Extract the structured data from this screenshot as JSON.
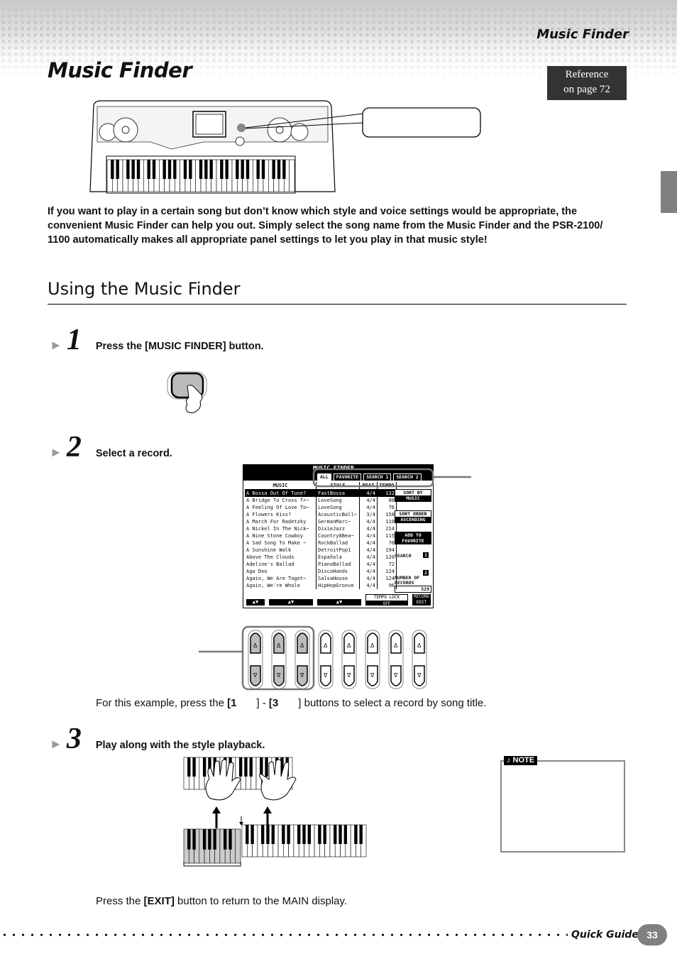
{
  "header": {
    "running_head": "Music Finder",
    "page_title": "Music Finder",
    "reference": {
      "line1": "Reference",
      "line2": "on page 72"
    }
  },
  "intro": "If you want to play in a certain song but don’t know which style and voice settings would be appropriate, the convenient Music Finder can help you out. Simply select the song name from the Music Finder and the PSR-2100/ 1100 automatically makes all appropriate panel settings to let you play in that music style!",
  "section": {
    "title": "Using the Music Finder"
  },
  "steps": [
    {
      "arrow": "►",
      "number": "1",
      "text": "Press the [MUSIC FINDER] button."
    },
    {
      "arrow": "►",
      "number": "2",
      "text": "Select a record."
    },
    {
      "arrow": "►",
      "number": "3",
      "text": "Play along with the style playback."
    }
  ],
  "lcd": {
    "title": "MUSIC FINDER",
    "tabs": [
      {
        "label": "ALL",
        "active": true
      },
      {
        "label": "FAVORITE",
        "active": false
      },
      {
        "label": "SEARCH 1",
        "active": false
      },
      {
        "label": "SEARCH 2",
        "active": false
      }
    ],
    "columns": [
      "MUSIC",
      "STYLE",
      "BEAT",
      "TEMPO"
    ],
    "rows": [
      {
        "music": "A Bossa Out Of Tune?",
        "style": "FastBossa",
        "beat": "4/4",
        "tempo": "132",
        "selected": true
      },
      {
        "music": "A Bridge To Cross Tr~",
        "style": "LoveSong",
        "beat": "4/4",
        "tempo": "80"
      },
      {
        "music": "A Feeling Of Love To~",
        "style": "LoveSong",
        "beat": "4/4",
        "tempo": "76"
      },
      {
        "music": "A Flowers Kiss?",
        "style": "AcousticBall~",
        "beat": "3/4",
        "tempo": "158"
      },
      {
        "music": "A March For Radetzky",
        "style": "GermanMarc~",
        "beat": "4/4",
        "tempo": "110"
      },
      {
        "music": "A Nickel In The Nick~",
        "style": "DixieJazz",
        "beat": "4/4",
        "tempo": "214"
      },
      {
        "music": "A Nine Stone Cowboy",
        "style": "Country8Bea~",
        "beat": "4/4",
        "tempo": "115"
      },
      {
        "music": "A Sad Song To Make ~",
        "style": "RockBallad",
        "beat": "4/4",
        "tempo": "76"
      },
      {
        "music": "A Sunshine Walk",
        "style": "DetroitPop1",
        "beat": "4/4",
        "tempo": "194"
      },
      {
        "music": "Above The Clouds",
        "style": "Española",
        "beat": "4/4",
        "tempo": "120"
      },
      {
        "music": "Adeline's Ballad",
        "style": "PianoBallad",
        "beat": "4/4",
        "tempo": "72"
      },
      {
        "music": "Aga Doo",
        "style": "DiscoHands",
        "beat": "4/4",
        "tempo": "124"
      },
      {
        "music": "Again, We Are Toget~",
        "style": "SalsaHouse",
        "beat": "4/4",
        "tempo": "124"
      },
      {
        "music": "Again, We're Whole",
        "style": "HipHopGroove",
        "beat": "4/4",
        "tempo": "96"
      }
    ],
    "side": {
      "sort_by": {
        "line1": "SORT BY",
        "line2": "MUSIC"
      },
      "sort_order": {
        "line1": "SORT ORDER",
        "line2": "ASCENDING"
      },
      "add_fav": {
        "line1": "ADD TO",
        "line2": "FAVORITE"
      },
      "search_label": "SEARCH",
      "search_1": "1",
      "search_2": "2",
      "records_label": "NUMBER OF RECORDS",
      "records_value": "529"
    },
    "bottom": {
      "updown": "▲▼",
      "tempo_lock": {
        "line1": "TEMPO LOCK",
        "line2": "OFF"
      },
      "record_edit": {
        "line1": "RECORD",
        "line2": "EDIT"
      }
    }
  },
  "step2_caption": {
    "prefix": "For this example, press the ",
    "b1": "[1",
    "mid": "] - ",
    "b2": "[3",
    "suffix": "] buttons to select a record by song title."
  },
  "note": {
    "label": "♪ NOTE"
  },
  "exit_text": {
    "prefix": "Press the ",
    "bold": "[EXIT]",
    "suffix": " button to return to the MAIN display."
  },
  "footer": {
    "label": "Quick Guide",
    "page_number": "33"
  }
}
